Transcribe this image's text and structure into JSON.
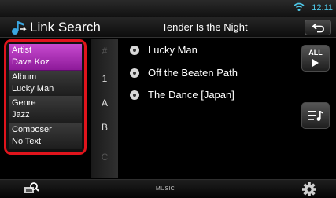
{
  "status_bar": {
    "time": "12:11",
    "wifi_icon": "wifi-icon"
  },
  "header": {
    "title": "Link Search",
    "title_icon": "note-link-icon",
    "now_playing": "Tender Is the Night",
    "back_icon": "return-arrow-icon"
  },
  "categories": [
    {
      "label": "Artist",
      "value": "Dave Koz",
      "selected": true
    },
    {
      "label": "Album",
      "value": "Lucky Man",
      "selected": false
    },
    {
      "label": "Genre",
      "value": "Jazz",
      "selected": false
    },
    {
      "label": "Composer",
      "value": "No Text",
      "selected": false
    }
  ],
  "index": [
    {
      "label": "#",
      "dim": true
    },
    {
      "label": "1",
      "dim": false
    },
    {
      "label": "A",
      "dim": false
    },
    {
      "label": "B",
      "dim": false
    },
    {
      "label": "C",
      "dim": true
    }
  ],
  "tracks": [
    "Lucky Man",
    "Off the Beaten Path",
    "The Dance [Japan]"
  ],
  "side_buttons": {
    "all_label": "ALL",
    "list_icon": "playlist-icon"
  },
  "bottom_bar": {
    "source": "MUSIC",
    "search_icon": "search-icon",
    "settings_icon": "gear-icon"
  },
  "colors": {
    "selected_category": "#b03ab8",
    "highlight_border": "#e0141c",
    "clock": "#4ec8e8"
  }
}
